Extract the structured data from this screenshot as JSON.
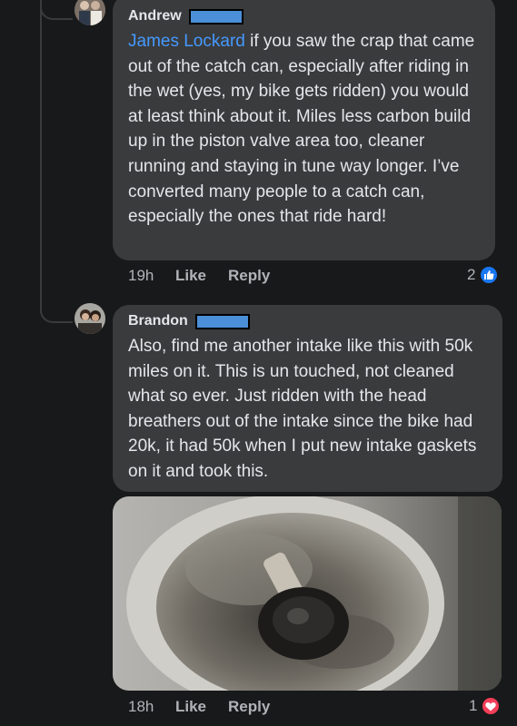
{
  "comments": [
    {
      "author": "Andrew",
      "mention": "James Lockard",
      "text": " if you saw the crap that came out of the catch can, especially after riding in the wet (yes, my bike gets ridden) you would at least think about it. Miles less carbon build up in the piston valve area too, cleaner running and staying in tune way longer. I’ve converted many people to a catch can, especially the ones that ride hard!",
      "time": "19h",
      "like_label": "Like",
      "reply_label": "Reply",
      "reaction_count": "2",
      "reaction_icon": "thumbs-up-icon",
      "reaction_color": "#1877f2"
    },
    {
      "author": "Brandon",
      "text": "Also, find me another intake like this with 50k miles on it. This is un touched, not cleaned what so ever. Just ridden with the head breathers out of the intake since the bike had 20k, it had 50k when I put new intake gaskets on it and took this.",
      "time": "18h",
      "like_label": "Like",
      "reply_label": "Reply",
      "reaction_count": "1",
      "reaction_icon": "heart-icon",
      "reaction_color": "#f33e58"
    }
  ],
  "colors": {
    "background": "#18191a",
    "bubble": "#3a3b3c",
    "text": "#e4e6eb",
    "secondary": "#b0b3b8",
    "mention": "#4599ff",
    "redaction": "#4a8fd8"
  }
}
